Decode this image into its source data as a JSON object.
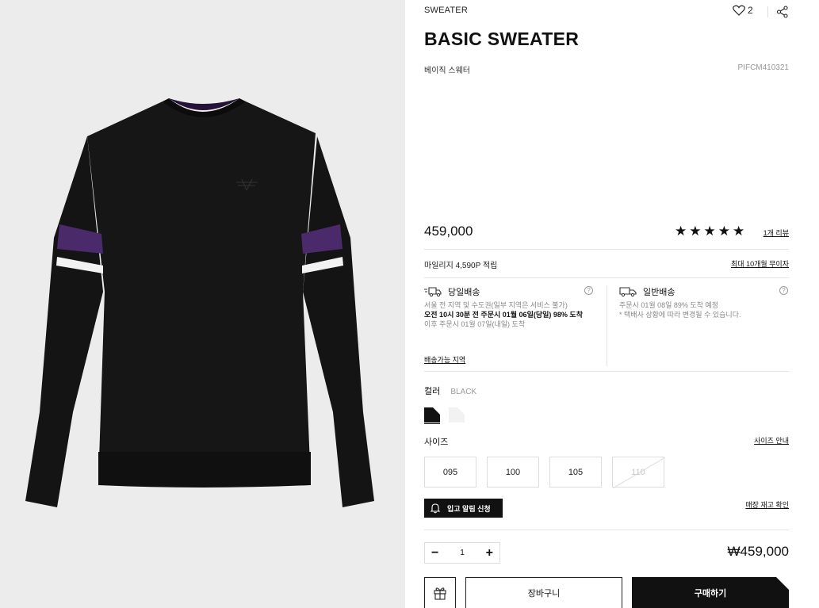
{
  "product": {
    "category": "SWEATER",
    "title": "BASIC SWEATER",
    "subtitle_kr": "베이직 스웨터",
    "code": "PIFCM410321",
    "price": "459,000",
    "like_count": "2",
    "rating": 5,
    "stars": [
      "★",
      "★",
      "★",
      "★",
      "★"
    ],
    "review_link": "1개 리뷰"
  },
  "benefits": {
    "mileage": "마일리지 4,590P 적립",
    "installment": "최대 10개월 무이자"
  },
  "shipping": {
    "same_day": {
      "title": "당일배송",
      "line1": "서울 전 지역 및 수도권(일부 지역은 서비스 불가)",
      "line2": "오전 10시 30분 전 주문시 01월 06일(당일) 98% 도착",
      "line3": "이후 주문시 01월 07일(내일) 도착",
      "area_link": "배송가능 지역"
    },
    "standard": {
      "title": "일반배송",
      "line1": "주문시 01월 08일 89% 도착 예정",
      "line2": "* 택배사 상황에 따라 변경될 수 있습니다."
    },
    "help_icon_glyph": "?"
  },
  "color": {
    "label": "컬러",
    "selected": "BLACK",
    "swatches": [
      {
        "name": "BLACK",
        "hex": "#111111"
      },
      {
        "name": "WHITE",
        "hex": "#f2f2f2"
      }
    ]
  },
  "size": {
    "label": "사이즈",
    "guide_link": "사이즈 안내",
    "options": [
      {
        "label": "095",
        "available": true
      },
      {
        "label": "100",
        "available": true
      },
      {
        "label": "105",
        "available": true
      },
      {
        "label": "110",
        "available": false
      }
    ]
  },
  "restock": {
    "notify_label": "입고 알림 신청",
    "store_stock_link": "매장 재고 확인"
  },
  "order": {
    "quantity": "1",
    "minus": "−",
    "plus": "+",
    "total": "₩459,000",
    "cart_label": "장바구니",
    "buy_label": "구매하기"
  },
  "colors": {
    "accent": "#111111",
    "sweater": "#131313",
    "stripe_purple": "#4b2a6b",
    "background_gallery": "#ececec"
  }
}
